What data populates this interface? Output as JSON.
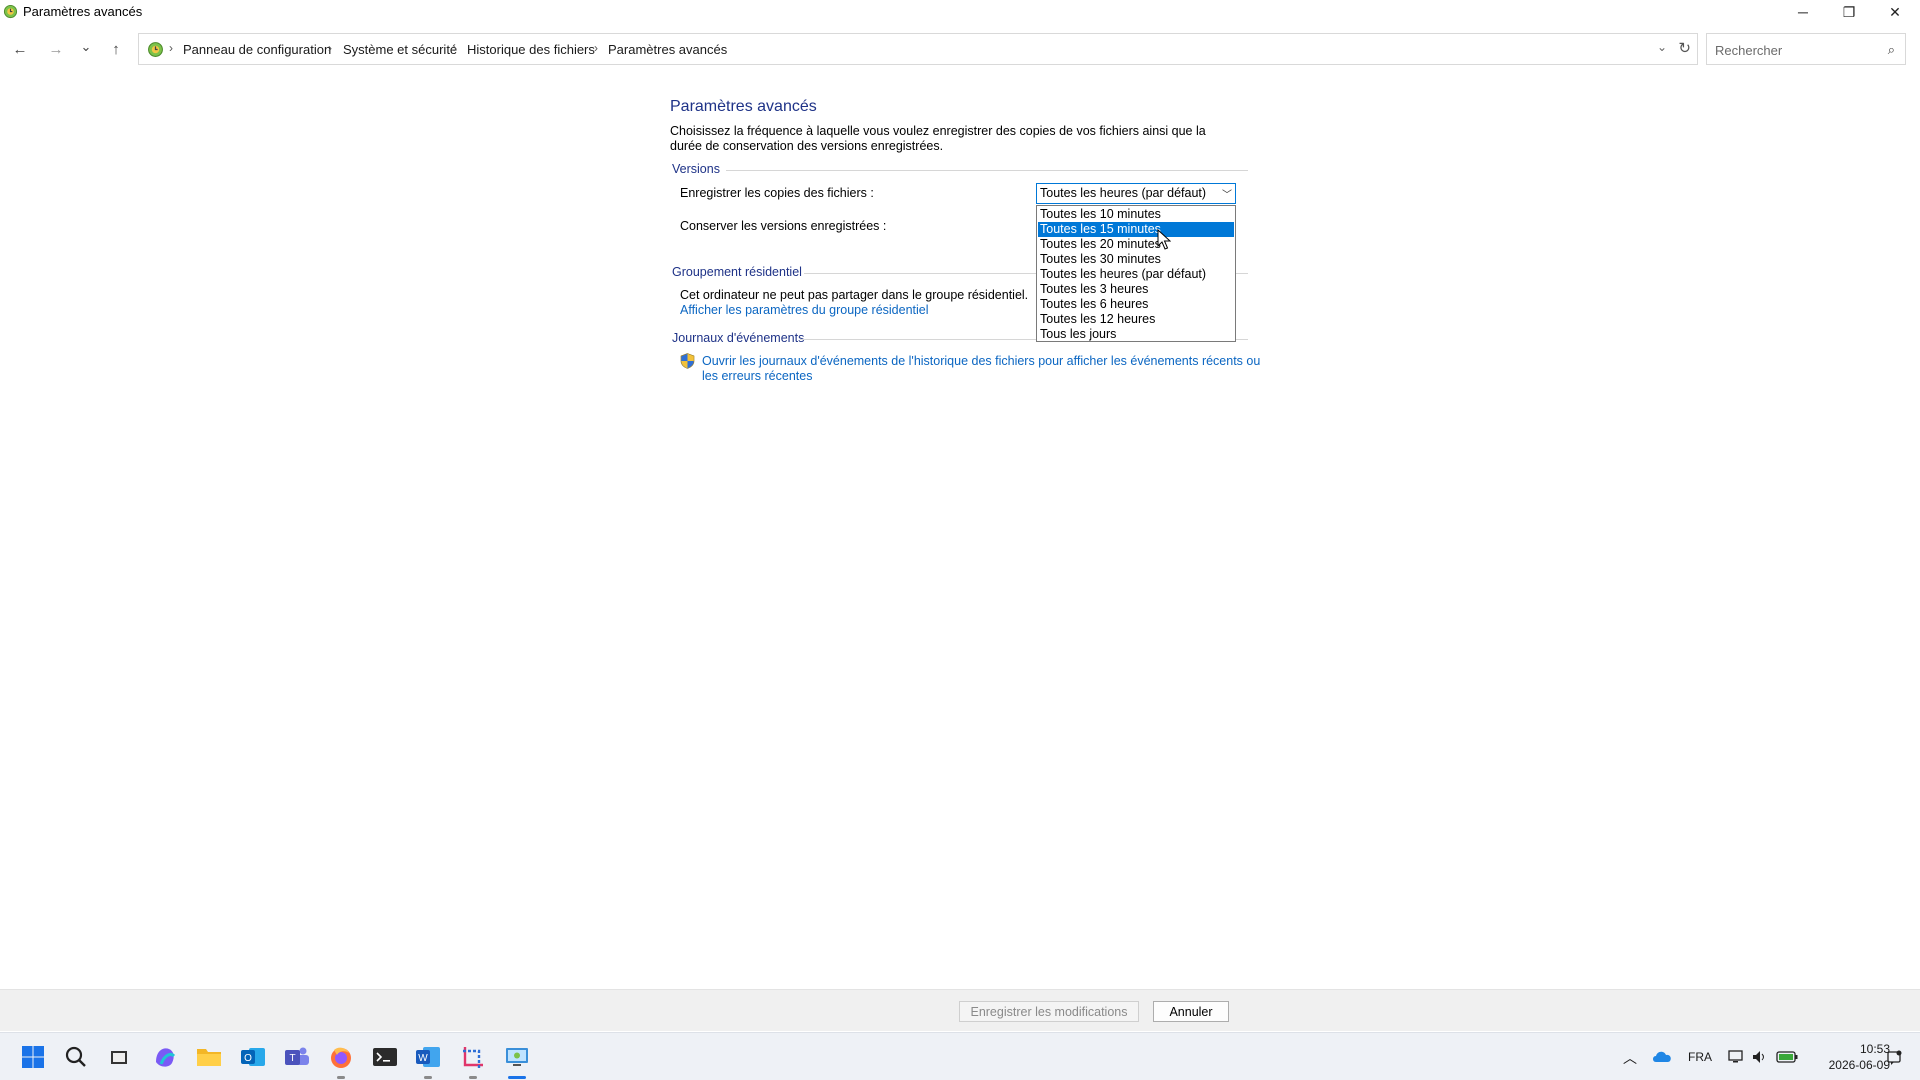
{
  "window": {
    "title": "Paramètres avancés",
    "controls": {
      "minimize": "─",
      "maximize": "❐",
      "close": "✕"
    }
  },
  "nav": {
    "back": "←",
    "forward": "→",
    "recent": "⌄",
    "up": "↑",
    "breadcrumb": [
      "Panneau de configuration",
      "Système et sécurité",
      "Historique des fichiers",
      "Paramètres avancés"
    ],
    "separator": "›",
    "search_placeholder": "Rechercher"
  },
  "page": {
    "heading": "Paramètres avancés",
    "description": "Choisissez la fréquence à laquelle vous voulez enregistrer des copies de vos fichiers ainsi que la durée de conservation des versions enregistrées.",
    "versions": {
      "title": "Versions",
      "save_copies_label": "Enregistrer les copies des fichiers :",
      "keep_versions_label": "Conserver les versions enregistrées :",
      "selected": "Toutes les heures (par défaut)",
      "options": [
        "Toutes les 10 minutes",
        "Toutes les 15 minutes",
        "Toutes les 20 minutes",
        "Toutes les 30 minutes",
        "Toutes les heures (par défaut)",
        "Toutes les 3 heures",
        "Toutes les 6 heures",
        "Toutes les 12 heures",
        "Tous les jours"
      ],
      "highlighted_option": "Toutes les 15 minutes"
    },
    "homegroup": {
      "title": "Groupement résidentiel",
      "text": "Cet ordinateur ne peut pas partager dans le groupe résidentiel.",
      "link": "Afficher les paramètres du groupe résidentiel"
    },
    "eventlogs": {
      "title": "Journaux d'événements",
      "link_line1": "Ouvrir les journaux d'événements de l'historique des fichiers pour afficher les événements récents ou",
      "link_line2": "les erreurs récentes"
    }
  },
  "buttons": {
    "save": "Enregistrer les modifications",
    "cancel": "Annuler"
  },
  "taskbar": {
    "language": "FRA",
    "time": "10:53",
    "date": "2026-06-09"
  },
  "colors": {
    "accent": "#0078d7",
    "heading": "#1e3287",
    "link": "#0b66c2"
  }
}
